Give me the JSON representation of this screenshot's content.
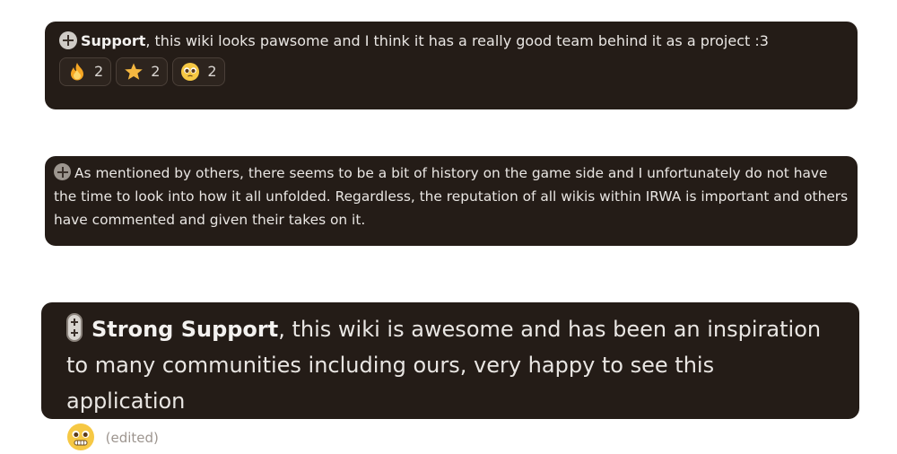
{
  "messages": [
    {
      "bold": "Support",
      "text": ", this wiki looks pawsome and I think it has a really good team behind it as a project :3",
      "reactions": [
        {
          "emoji": "fire-emoji",
          "count": "2"
        },
        {
          "emoji": "star-emoji",
          "count": "2"
        },
        {
          "emoji": "pleading-face-emoji",
          "count": "2"
        }
      ]
    },
    {
      "text": "As mentioned by others, there seems to be a bit of history on the game side and I unfortunately do not have the time to look into how it all unfolded. Regardless, the reputation of all wikis within IRWA is important and others have commented and given their takes on it."
    },
    {
      "bold": "Strong Support",
      "text": ", this wiki is awesome and has been an inspiration to many communities including ours, very happy to see this application",
      "emoji": "grimacing-face-emoji",
      "edited": "(edited)"
    }
  ],
  "colors": {
    "background": "#241c17",
    "text": "#e9e6e3",
    "muted": "#9d958f"
  }
}
